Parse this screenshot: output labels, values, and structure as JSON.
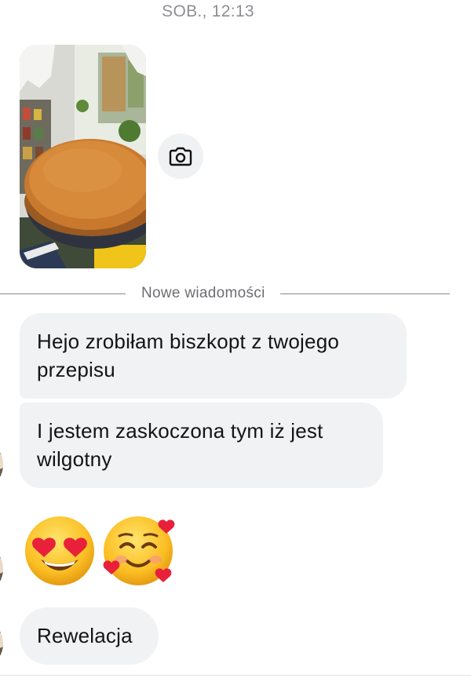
{
  "conversation": {
    "timestamp": "SOB., 12:13",
    "photo_message": {
      "description_icon": "photo-thumbnail",
      "share_icon": "camera-icon"
    },
    "divider_text": "Nowe wiadomości",
    "messages": [
      {
        "text": "Hejo zrobiłam biszkopt z twojego przepisu"
      },
      {
        "text": "I jestem zaskoczona tym iż jest wilgotny"
      },
      {
        "text": "Rewelacja"
      }
    ],
    "emoji_message": {
      "emojis": [
        "smiling-face-with-heart-eyes",
        "smiling-face-with-hearts"
      ]
    }
  },
  "colors": {
    "bubble_background": "#f1f2f4",
    "timestamp_text": "#8e8e93",
    "divider_line": "#8a8a8a",
    "camera_button_bg": "#f0f1f3"
  }
}
